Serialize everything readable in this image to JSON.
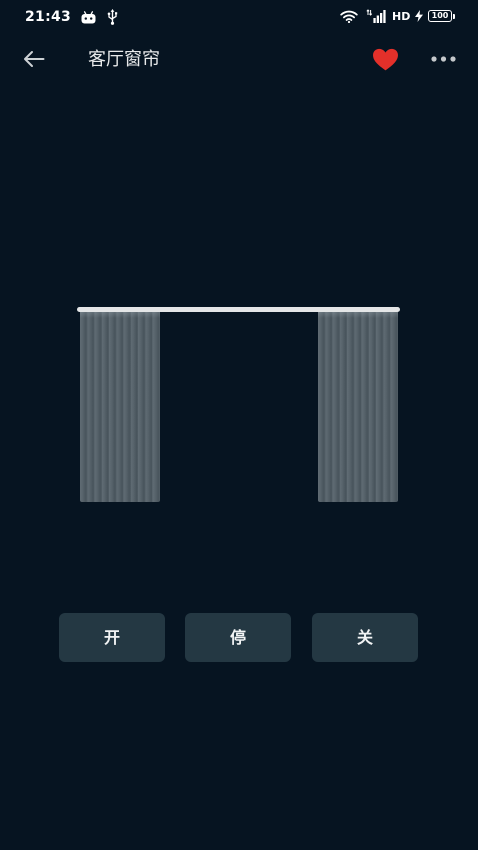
{
  "status_bar": {
    "time": "21:43",
    "icons_left": [
      "android-icon",
      "usb-icon"
    ],
    "icons_right": [
      "wifi-icon",
      "signal-icon",
      "charging-icon",
      "battery-icon"
    ],
    "network_label": "HD",
    "battery_level": "100"
  },
  "header": {
    "back_icon": "arrow-left-icon",
    "title": "客厅窗帘",
    "favorite_icon": "heart-icon",
    "favorite_active": true,
    "more_icon": "more-horizontal-icon"
  },
  "curtain": {
    "closed_fraction": 0.5
  },
  "controls": {
    "open_label": "开",
    "stop_label": "停",
    "close_label": "关"
  },
  "colors": {
    "background": "#061421",
    "heart": "#e3302a",
    "button_bg": "#243843",
    "curtain_fabric": "#56626a",
    "rod": "#e4e6e7"
  }
}
